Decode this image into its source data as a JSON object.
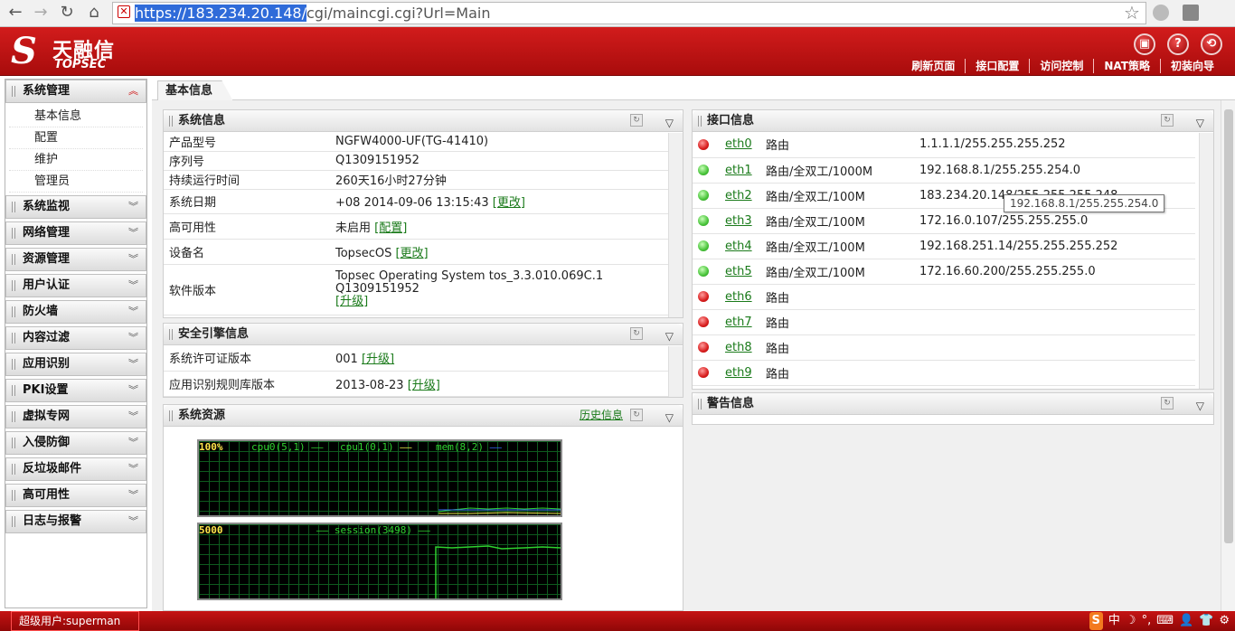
{
  "browser": {
    "url_proto": "https://",
    "url_host": "183.234.20.148/",
    "url_path": "cgi/maincgi.cgi?Url=Main"
  },
  "logo": {
    "mark": "S",
    "cn": "天融信",
    "en": "TOPSEC"
  },
  "topnav": [
    "刷新页面",
    "接口配置",
    "访问控制",
    "NAT策略",
    "初装向导"
  ],
  "sidebar": {
    "groups": [
      {
        "label": "系统管理",
        "expanded": true,
        "items": [
          "基本信息",
          "配置",
          "维护",
          "管理员"
        ]
      },
      {
        "label": "系统监视"
      },
      {
        "label": "网络管理"
      },
      {
        "label": "资源管理"
      },
      {
        "label": "用户认证"
      },
      {
        "label": "防火墙"
      },
      {
        "label": "内容过滤"
      },
      {
        "label": "应用识别"
      },
      {
        "label": "PKI设置"
      },
      {
        "label": "虚拟专网"
      },
      {
        "label": "入侵防御"
      },
      {
        "label": "反垃圾邮件"
      },
      {
        "label": "高可用性"
      },
      {
        "label": "日志与报警"
      }
    ]
  },
  "tab": "基本信息",
  "sysinfo": {
    "title": "系统信息",
    "rows": [
      {
        "k": "产品型号",
        "v": "NGFW4000-UF(TG-41410)"
      },
      {
        "k": "序列号",
        "v": "Q1309151952"
      },
      {
        "k": "持续运行时间",
        "v": "260天16小时27分钟"
      },
      {
        "k": "系统日期",
        "v": "+08 2014-09-06 13:15:43",
        "link": "[更改]"
      },
      {
        "k": "高可用性",
        "v": "未启用",
        "link": "[配置]"
      },
      {
        "k": "设备名",
        "v": "TopsecOS",
        "link": "[更改]"
      },
      {
        "k": "软件版本",
        "v": "Topsec Operating System tos_3.3.010.069C.1",
        "v2": "Q1309151952",
        "link": "[升级]"
      }
    ]
  },
  "engine": {
    "title": "安全引擎信息",
    "rows": [
      {
        "k": "系统许可证版本",
        "v": "001",
        "link": "[升级]"
      },
      {
        "k": "应用识别规则库版本",
        "v": "2013-08-23",
        "link": "[升级]"
      }
    ]
  },
  "resources": {
    "title": "系统资源",
    "history": "历史信息",
    "graph1": {
      "max_label": "100%",
      "legend": [
        "cpu0(5,1)",
        "cpu1(0,1)",
        "mem(8,2)"
      ],
      "colors": [
        "#2fd12f",
        "#e8e84a",
        "#3a6cff"
      ]
    },
    "graph2": {
      "max_label": "5000",
      "legend": [
        "session(3498)"
      ],
      "colors": [
        "#e8e84a"
      ]
    }
  },
  "interfaces": {
    "title": "接口信息",
    "rows": [
      {
        "status": "down",
        "name": "eth0",
        "mode": "路由",
        "addr": "1.1.1.1/255.255.255.252"
      },
      {
        "status": "up",
        "name": "eth1",
        "mode": "路由/全双工/1000M",
        "addr": "192.168.8.1/255.255.254.0"
      },
      {
        "status": "up",
        "name": "eth2",
        "mode": "路由/全双工/100M",
        "addr": "183.234.20.148/255.255.255.248"
      },
      {
        "status": "up",
        "name": "eth3",
        "mode": "路由/全双工/100M",
        "addr": "172.16.0.107/255.255.255.0"
      },
      {
        "status": "up",
        "name": "eth4",
        "mode": "路由/全双工/100M",
        "addr": "192.168.251.14/255.255.255.252"
      },
      {
        "status": "up",
        "name": "eth5",
        "mode": "路由/全双工/100M",
        "addr": "172.16.60.200/255.255.255.0"
      },
      {
        "status": "down",
        "name": "eth6",
        "mode": "路由",
        "addr": ""
      },
      {
        "status": "down",
        "name": "eth7",
        "mode": "路由",
        "addr": ""
      },
      {
        "status": "down",
        "name": "eth8",
        "mode": "路由",
        "addr": ""
      },
      {
        "status": "down",
        "name": "eth9",
        "mode": "路由",
        "addr": ""
      }
    ],
    "tooltip": "192.168.8.1/255.255.254.0"
  },
  "alerts": {
    "title": "警告信息"
  },
  "status": {
    "user": "超级用户:superman"
  },
  "tray": [
    "S",
    "中",
    "☽",
    "°,",
    "⌨",
    "👤",
    "👕",
    "⚙"
  ]
}
